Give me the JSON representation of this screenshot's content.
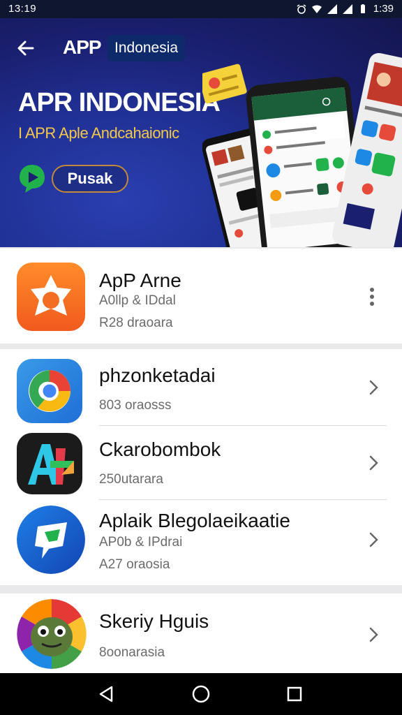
{
  "status_bar": {
    "time_left": "13:19",
    "time_right": "1:39"
  },
  "hero": {
    "logo": "APP",
    "country": "Indonesia",
    "headline": "APR INDONESIA",
    "subline": "I APR Aple Andcahaionic",
    "cta_label": "Pusak"
  },
  "featured_app": {
    "name": "ApP Arne",
    "line1": "A0llp & IDdal",
    "line2": "R28 draoara"
  },
  "apps": [
    {
      "name": "phzonketadai",
      "line1": "",
      "line2": "803 oraosss"
    },
    {
      "name": "Ckarobombok",
      "line1": "",
      "line2": "250utarara"
    },
    {
      "name": "Aplaik Blegolaeikaatie",
      "line1": "AP0b & IPdrai",
      "line2": "A27 oraosia"
    }
  ],
  "bottom_app": {
    "name": "Skeriy Hguis",
    "line2": "8oonarasia"
  },
  "colors": {
    "hero_bg": "#1f2d8f",
    "accent_gold": "#f3c84a",
    "navbar": "#000000"
  }
}
